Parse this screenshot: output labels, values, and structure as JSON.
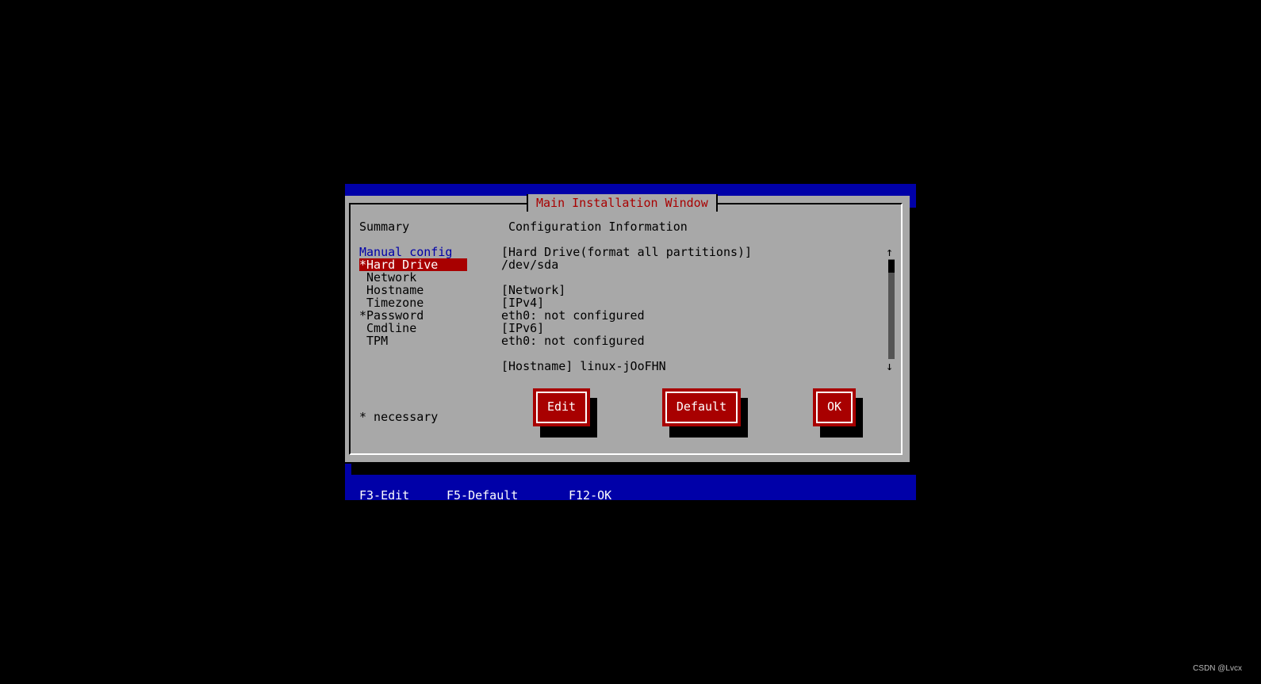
{
  "window": {
    "title": "Main Installation Window",
    "summary_heading": "Summary",
    "config_heading": "Configuration Information"
  },
  "menu": {
    "items": [
      {
        "label": "Manual config",
        "kind": "group"
      },
      {
        "label": "*Hard Drive",
        "kind": "selected"
      },
      {
        "label": " Network",
        "kind": "item"
      },
      {
        "label": " Hostname",
        "kind": "item"
      },
      {
        "label": " Timezone",
        "kind": "item"
      },
      {
        "label": "*Password",
        "kind": "item"
      },
      {
        "label": " Cmdline",
        "kind": "item"
      },
      {
        "label": " TPM",
        "kind": "item"
      }
    ],
    "note": "* necessary"
  },
  "info": {
    "lines": [
      "[Hard Drive(format all partitions)]",
      "/dev/sda",
      "",
      "[Network]",
      "[IPv4]",
      "eth0: not configured",
      "[IPv6]",
      "eth0: not configured",
      "",
      "[Hostname] linux-jOoFHN"
    ],
    "scroll_up": "↑",
    "scroll_down": "↓"
  },
  "buttons": {
    "edit": "Edit",
    "default": "Default",
    "ok": "OK"
  },
  "shortcuts": {
    "edit": "F3-Edit",
    "default": "F5-Default",
    "ok": "F12-OK"
  },
  "watermark": "CSDN @Lvcx",
  "colors": {
    "background": "#000000",
    "screen_blue": "#0000a8",
    "window_gray": "#a8a8a8",
    "accent_red": "#a80000",
    "group_blue": "#0000a8"
  }
}
